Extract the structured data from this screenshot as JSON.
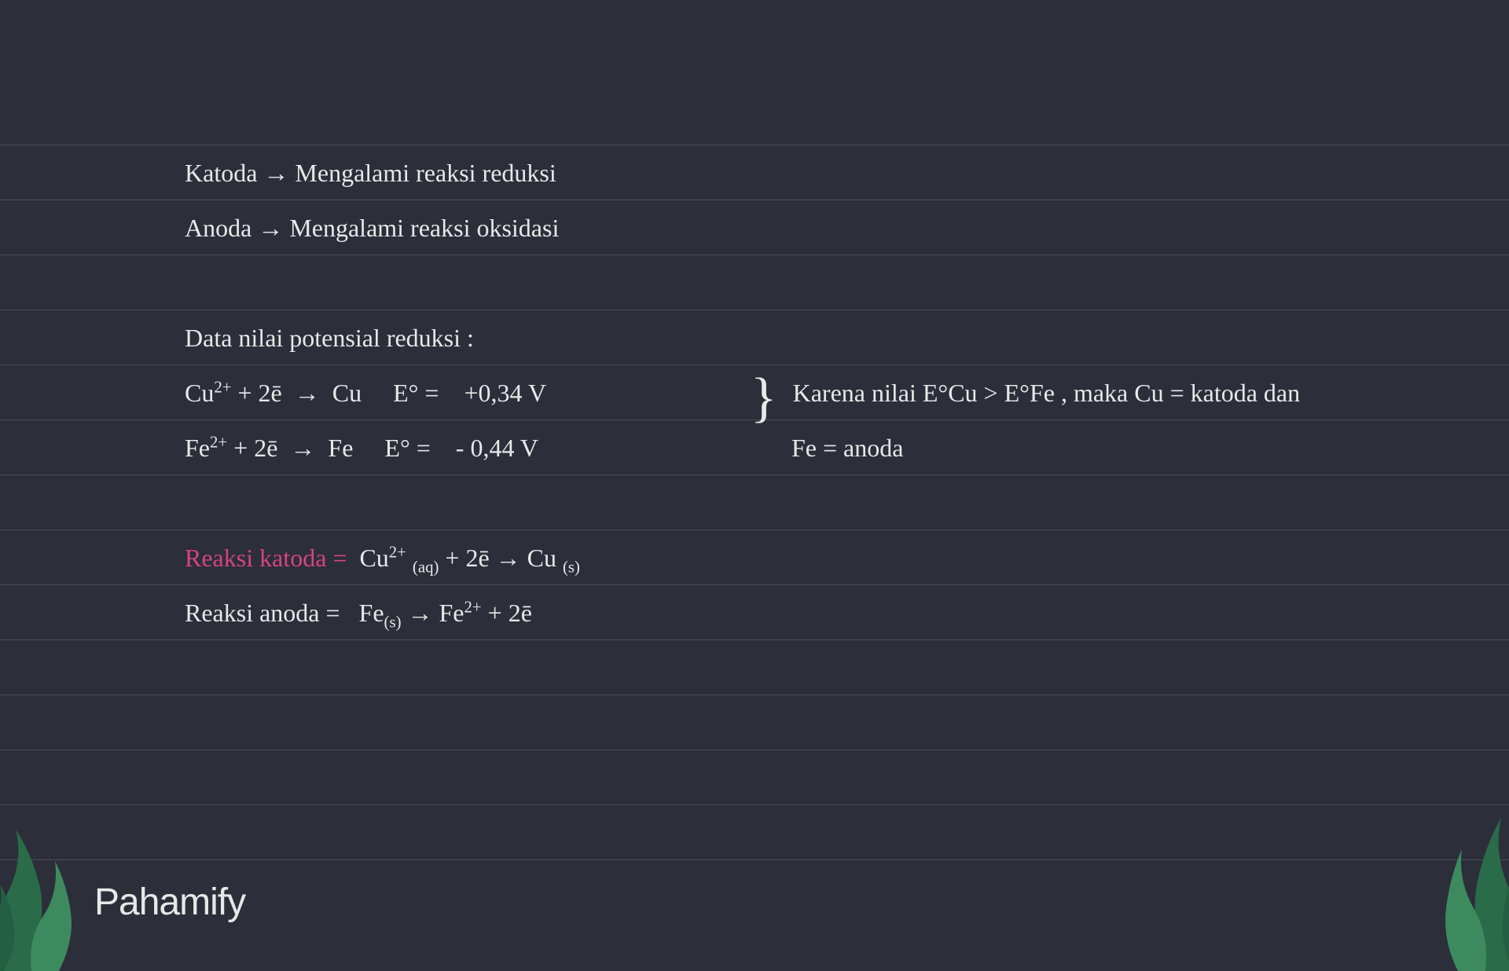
{
  "katoda_label": "Katoda",
  "katoda_desc": "Mengalami reaksi reduksi",
  "anoda_label": "Anoda",
  "anoda_desc": "Mengalami reaksi oksidasi",
  "data_title": "Data nilai potensial reduksi :",
  "cu_reaction_left": "Cu²⁺ + 2ē",
  "cu_reaction_right": "Cu",
  "cu_e_label": "E° =",
  "cu_e_value": "+0,34 V",
  "fe_reaction_left": "Fe²⁺ + 2ē",
  "fe_reaction_right": "Fe",
  "fe_e_label": "E° =",
  "fe_e_value": "- 0,44 V",
  "conclusion_line1": "Karena nilai E°Cu > E°Fe , maka Cu = katoda dan",
  "conclusion_line2": "Fe = anoda",
  "reaksi_katoda_label": "Reaksi katoda =",
  "reaksi_katoda_left": "Cu²⁺ (aq) + 2ē",
  "reaksi_katoda_right": "Cu (s)",
  "reaksi_anoda_label": "Reaksi anoda =",
  "reaksi_anoda_left": "Fe(s)",
  "reaksi_anoda_right": "Fe²⁺ + 2ē",
  "arrow_symbol": "→",
  "logo_text": "Pahamify"
}
